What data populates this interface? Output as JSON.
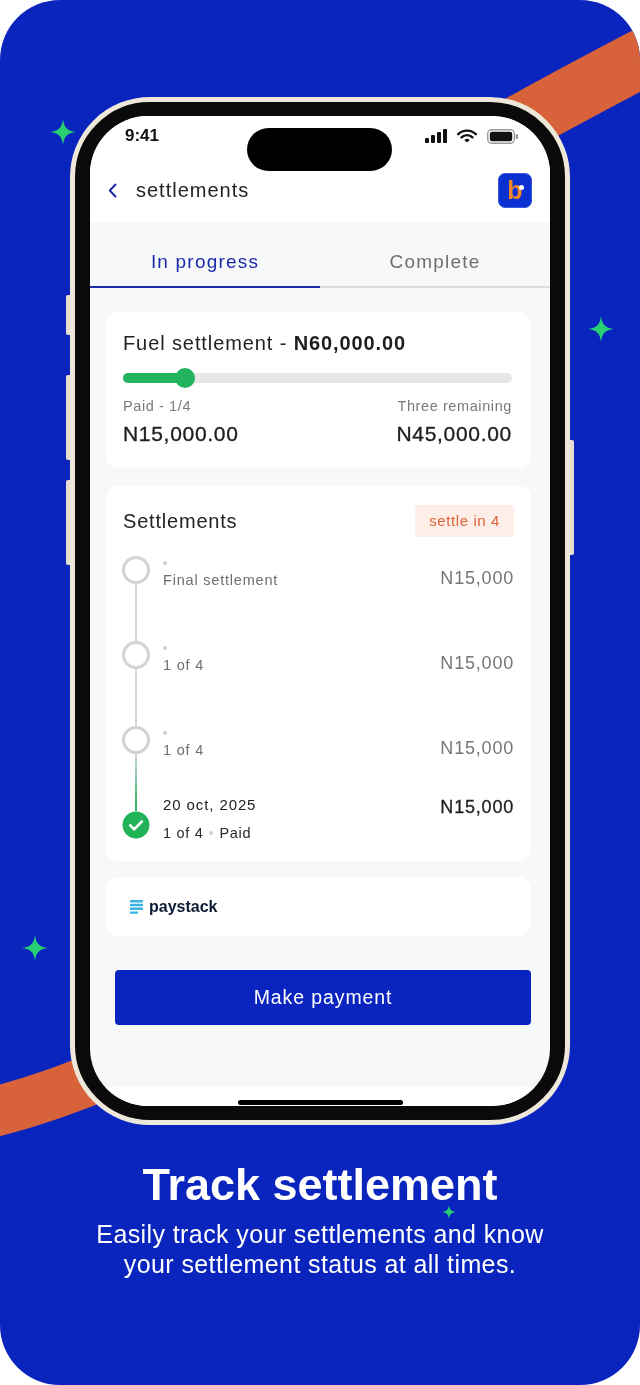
{
  "status_bar": {
    "time": "9:41"
  },
  "header": {
    "title": "settlements",
    "logo_letter": "b"
  },
  "tabs": [
    {
      "label": "In progress",
      "selected": true
    },
    {
      "label": "Complete",
      "selected": false
    }
  ],
  "summary": {
    "title": "Fuel settlement - **N60,000.00**",
    "level": 0.16,
    "paid_label": "Paid - 1/4",
    "remaining_label": "Three remaining",
    "paid_amount": "N15,000.00",
    "remaining_amount": "N45,000.00"
  },
  "settlements": {
    "title": "Settlements",
    "badge": "settle in 4",
    "items": [
      {
        "label": "Final settlement",
        "amount": "N15,000",
        "paid": false
      },
      {
        "label": "1 of 4",
        "amount": "N15,000",
        "paid": false
      },
      {
        "label": "1 of 4",
        "amount": "N15,000",
        "paid": false
      },
      {
        "date": "20 oct, 2025",
        "label": "1 of 4",
        "status": "Paid",
        "amount": "N15,000",
        "paid": true
      }
    ]
  },
  "payment_provider": {
    "name": "paystack"
  },
  "primary_button": {
    "label": "Make payment"
  },
  "caption": {
    "title": "Track settlement",
    "text": "Easily track your settlements and know your settlement status at all times."
  }
}
